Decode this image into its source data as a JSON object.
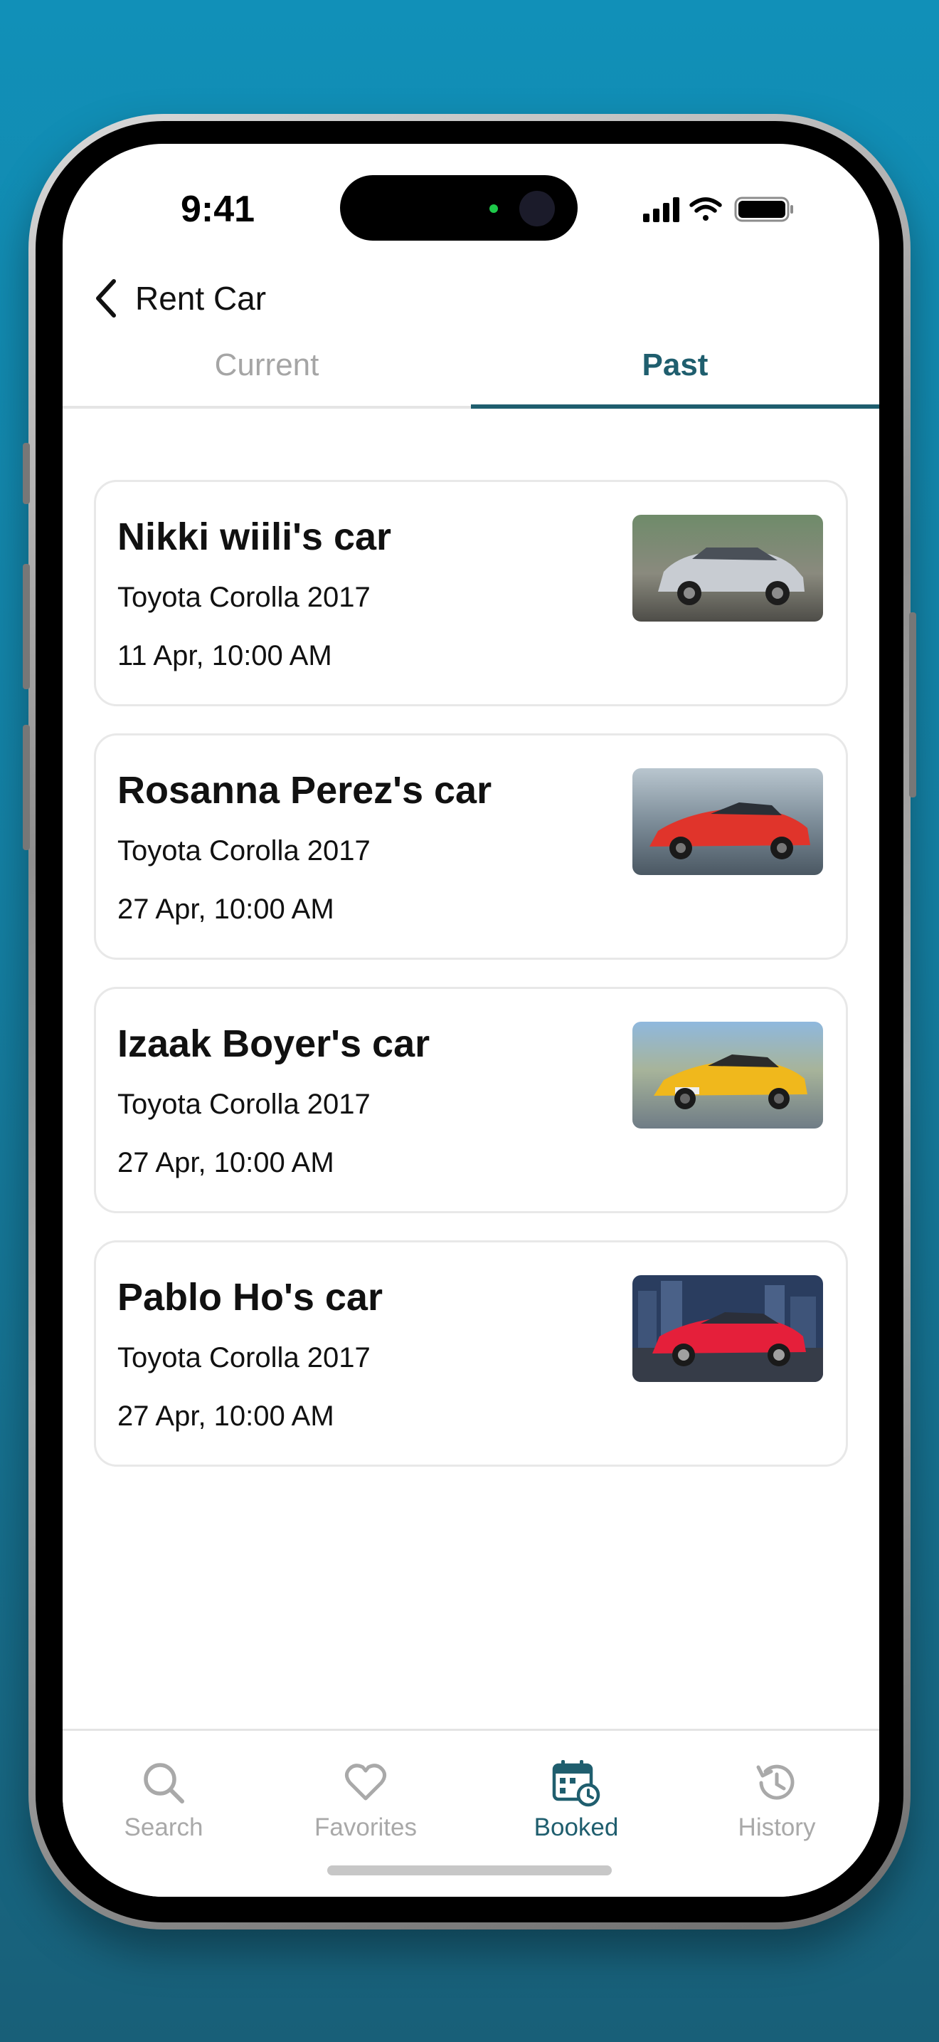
{
  "status_bar": {
    "time": "9:41"
  },
  "header": {
    "title": "Rent Car",
    "back_icon": "chevron-left-icon"
  },
  "tabs": [
    {
      "label": "Current",
      "selected": false
    },
    {
      "label": "Past",
      "selected": true
    }
  ],
  "bookings": [
    {
      "owner": "Nikki wiili's car",
      "model": "Toyota Corolla 2017",
      "date": "11 Apr, 10:00 AM",
      "car_color": "#c8ccd2"
    },
    {
      "owner": "Rosanna Perez's car",
      "model": "Toyota Corolla 2017",
      "date": "27 Apr, 10:00 AM",
      "car_color": "#e0342b"
    },
    {
      "owner": "Izaak Boyer's car",
      "model": "Toyota Corolla 2017",
      "date": "27 Apr, 10:00 AM",
      "car_color": "#f0b81c"
    },
    {
      "owner": "Pablo Ho's car",
      "model": "Toyota Corolla 2017",
      "date": "27 Apr, 10:00 AM",
      "car_color": "#e51f3a"
    }
  ],
  "bottom_nav": [
    {
      "label": "Search",
      "icon": "search-icon",
      "active": false
    },
    {
      "label": "Favorites",
      "icon": "heart-icon",
      "active": false
    },
    {
      "label": "Booked",
      "icon": "calendar-clock-icon",
      "active": true
    },
    {
      "label": "History",
      "icon": "history-icon",
      "active": false
    }
  ],
  "colors": {
    "accent": "#1f5e6e",
    "inactive": "#a9a9a9",
    "background_top": "#1190b8",
    "background_bottom": "#185f78"
  }
}
